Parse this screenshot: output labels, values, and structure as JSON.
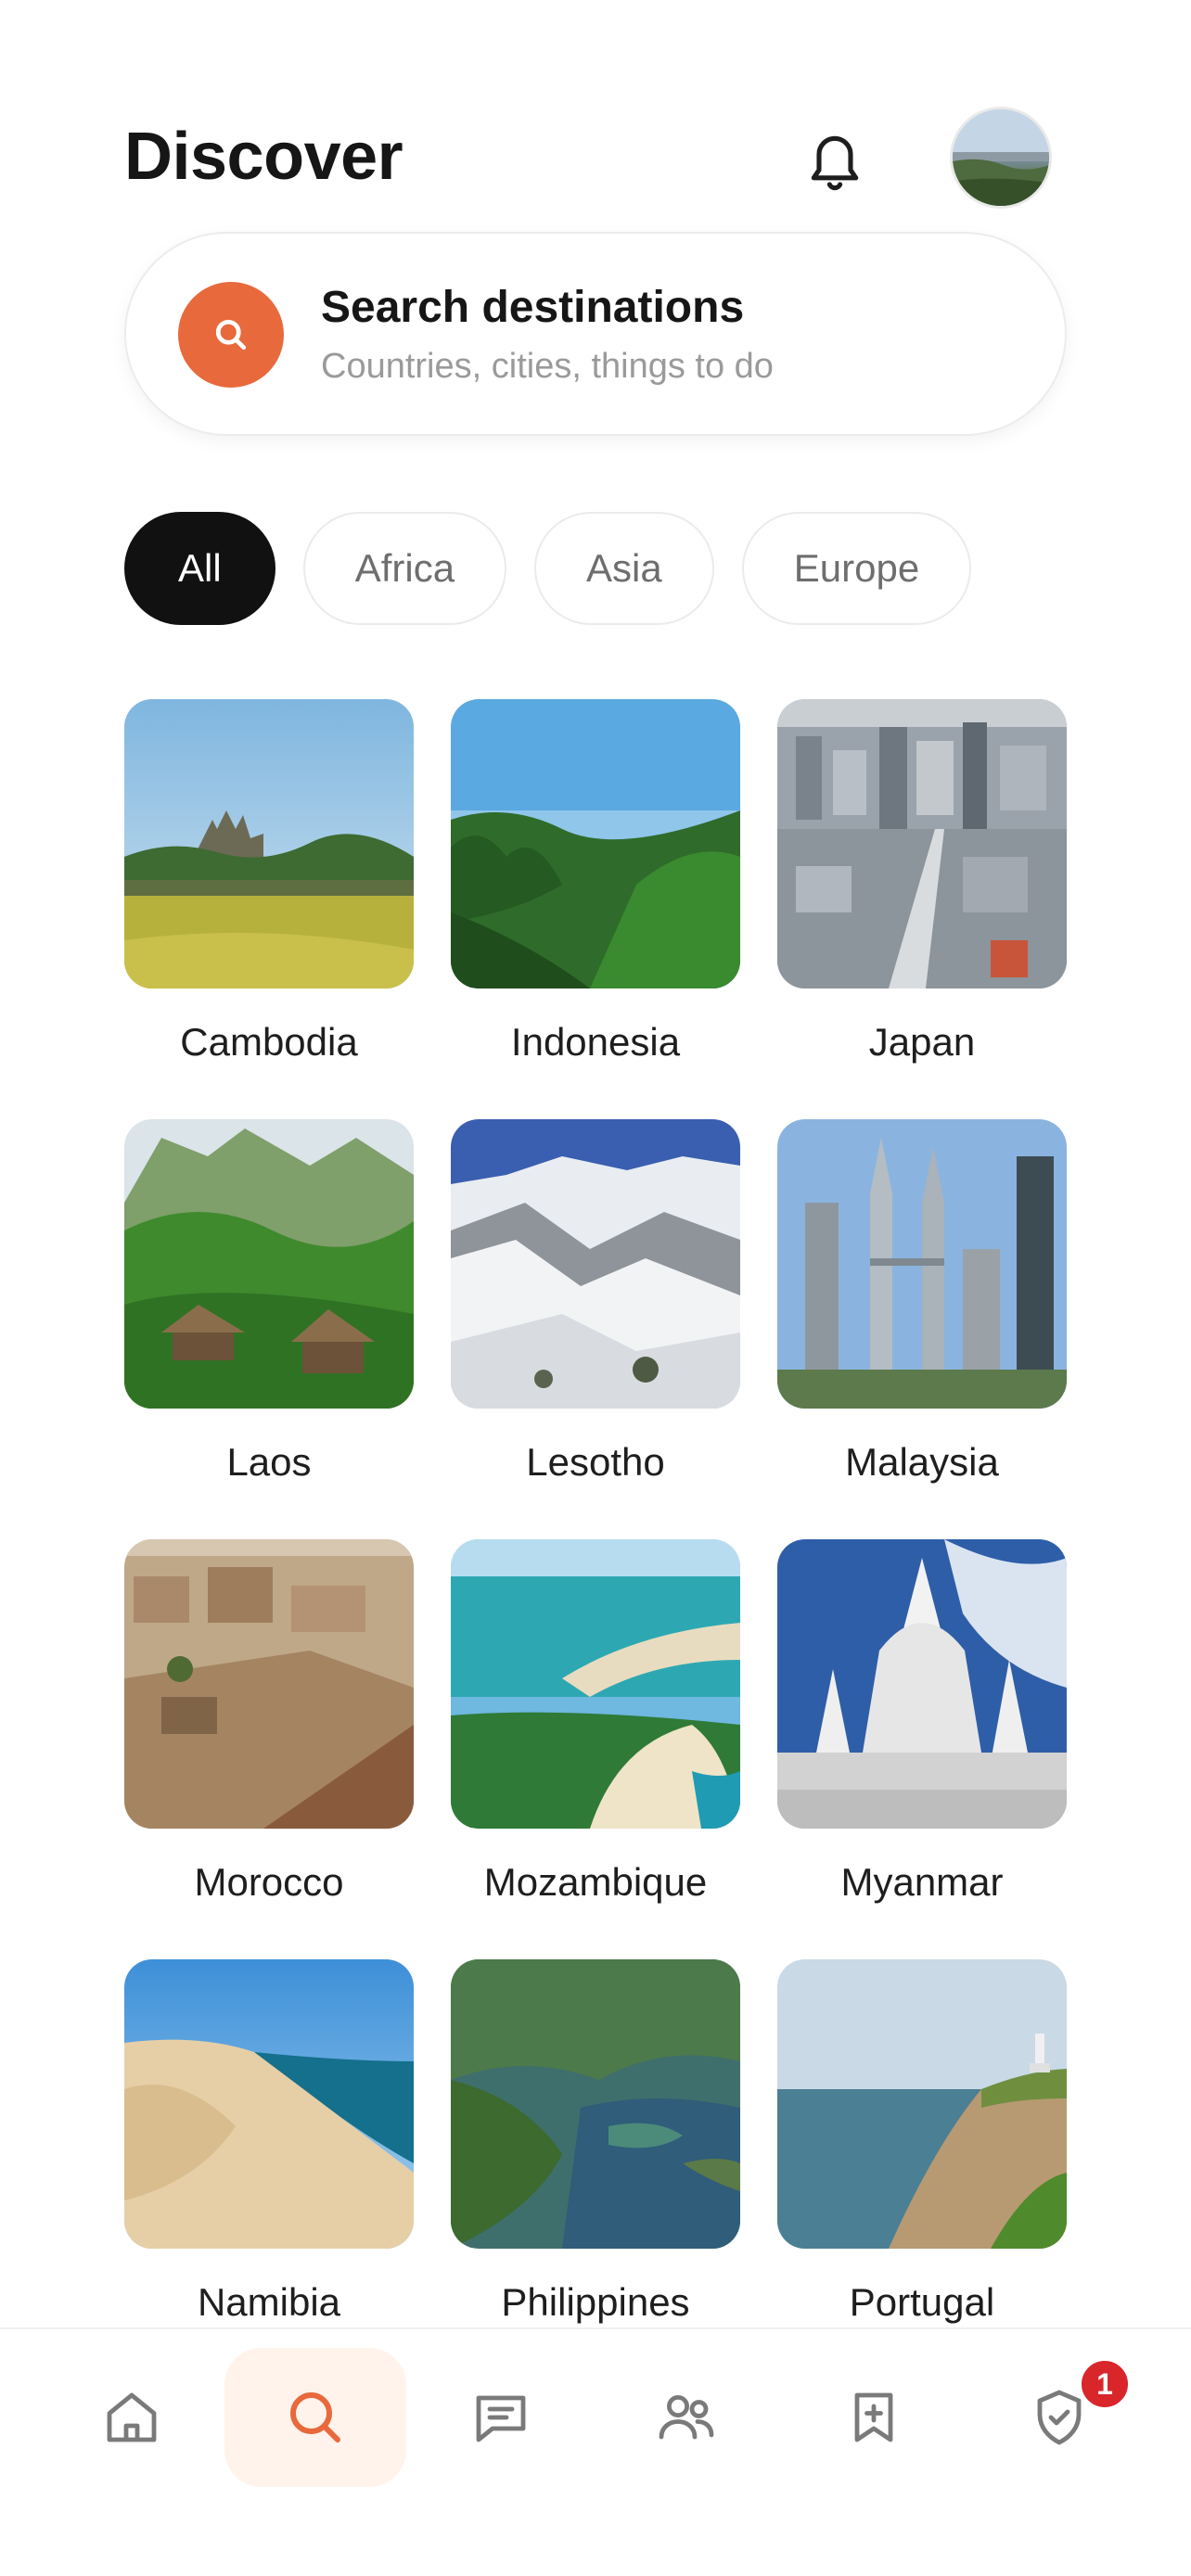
{
  "header": {
    "title": "Discover",
    "bell_icon": "bell-icon",
    "avatar": "user-avatar"
  },
  "search": {
    "title": "Search destinations",
    "placeholder": "Countries, cities, things to do",
    "icon": "search-icon",
    "accent": "#e8693b"
  },
  "filters": [
    {
      "label": "All",
      "active": true
    },
    {
      "label": "Africa",
      "active": false
    },
    {
      "label": "Asia",
      "active": false
    },
    {
      "label": "Europe",
      "active": false
    }
  ],
  "destinations": [
    {
      "name": "Cambodia",
      "image": "angkor-wat-photo"
    },
    {
      "name": "Indonesia",
      "image": "jungle-photo"
    },
    {
      "name": "Japan",
      "image": "city-skyline-photo"
    },
    {
      "name": "Laos",
      "image": "village-huts-photo"
    },
    {
      "name": "Lesotho",
      "image": "snowy-mountains-photo"
    },
    {
      "name": "Malaysia",
      "image": "petronas-towers-photo"
    },
    {
      "name": "Morocco",
      "image": "kasbah-photo"
    },
    {
      "name": "Mozambique",
      "image": "coast-island-photo"
    },
    {
      "name": "Myanmar",
      "image": "white-pagoda-photo"
    },
    {
      "name": "Namibia",
      "image": "desert-dunes-photo"
    },
    {
      "name": "Philippines",
      "image": "lagoon-islands-photo"
    },
    {
      "name": "Portugal",
      "image": "cliff-lighthouse-photo"
    }
  ],
  "nav": {
    "items": [
      "home-icon",
      "search-icon",
      "chat-icon",
      "people-icon",
      "bookmark-add-icon",
      "shield-check-icon"
    ],
    "active_index": 1,
    "badge_count": "1",
    "badge_color": "#d8262b"
  }
}
